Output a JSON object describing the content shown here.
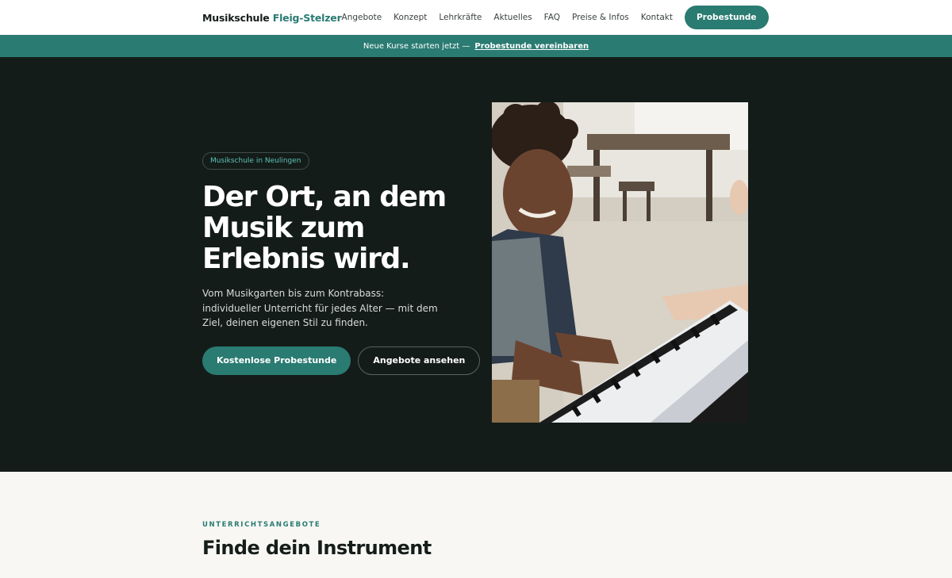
{
  "header": {
    "logo_main": "Musikschule",
    "logo_accent": "Fleig-Stelzer",
    "nav": [
      "Angebote",
      "Konzept",
      "Lehrkräfte",
      "Aktuelles",
      "FAQ",
      "Preise & Infos",
      "Kontakt"
    ],
    "cta_label": "Probestunde"
  },
  "banner": {
    "text": "Neue Kurse starten jetzt —",
    "link": "Probestunde vereinbaren"
  },
  "hero": {
    "badge": "Musikschule in Neulingen",
    "title_lines": [
      "Der Ort, an dem",
      "Musik zum",
      "Erlebnis wird."
    ],
    "text": "Vom Musikgarten bis zum Kontrabass: individueller Unterricht für jedes Alter — mit dem Ziel, deinen eigenen Stil zu finden.",
    "primary_button": "Kostenlose Probestunde",
    "secondary_button": "Angebote ansehen"
  },
  "section": {
    "eyebrow": "UNTERRICHTSANGEBOTE",
    "title": "Finde dein Instrument"
  },
  "colors": {
    "accent": "#2a7b72",
    "hero_bg": "#141c1a",
    "badge_text": "#5ec2b5"
  }
}
